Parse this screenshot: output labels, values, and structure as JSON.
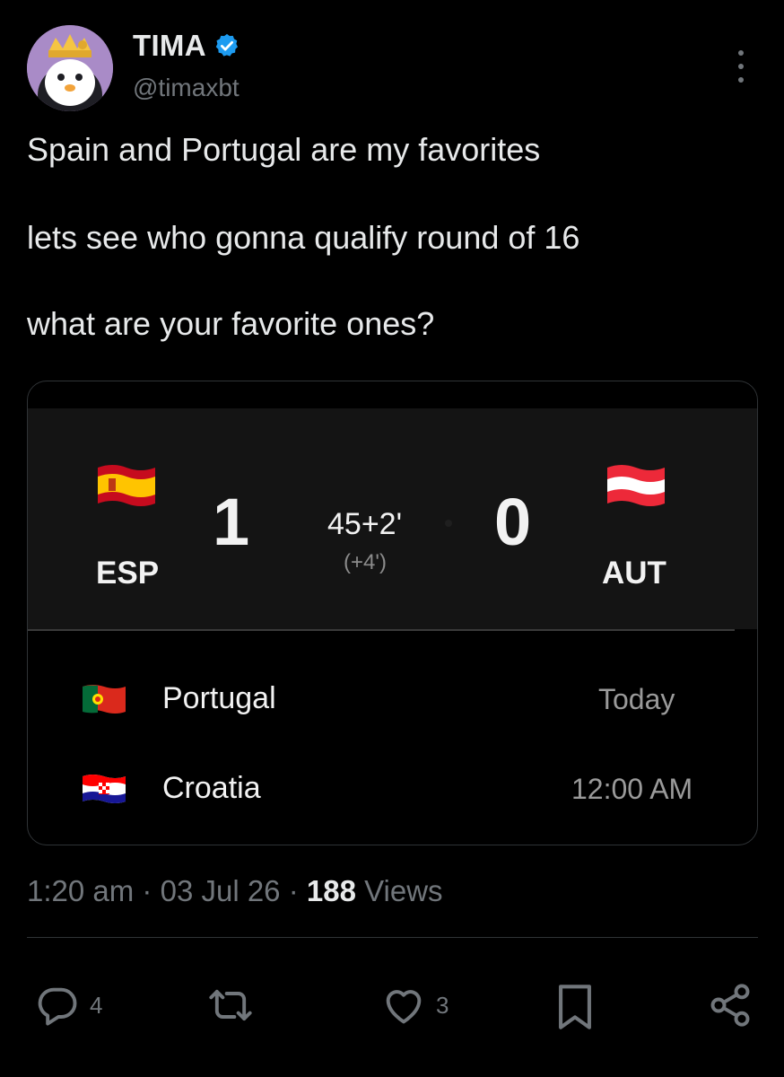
{
  "author": {
    "display_name": "TIMA",
    "handle": "@timaxbt",
    "verified": true
  },
  "tweet": {
    "lines": [
      "Spain and Portugal are my favorites",
      "lets see who gonna qualify round of 16",
      "what are your favorite ones?"
    ]
  },
  "card": {
    "live_match": {
      "home": {
        "code": "ESP",
        "score": "1",
        "flag": "spain-flag-icon"
      },
      "away": {
        "code": "AUT",
        "score": "0",
        "flag": "austria-flag-icon"
      },
      "clock": "45+2'",
      "added_time": "(+4')"
    },
    "fixture": {
      "home": "Portugal",
      "away": "Croatia",
      "date": "Today",
      "time": "12:00 AM"
    }
  },
  "meta": {
    "time": "1:20 am",
    "date": "03 Jul 26",
    "views_count": "188",
    "views_label": "Views",
    "separator": "·"
  },
  "actions": {
    "reply_count": "4",
    "like_count": "3"
  },
  "colors": {
    "background": "#000000",
    "text": "#e7e9ea",
    "secondary": "#71767b",
    "verified": "#1d9bf0"
  }
}
